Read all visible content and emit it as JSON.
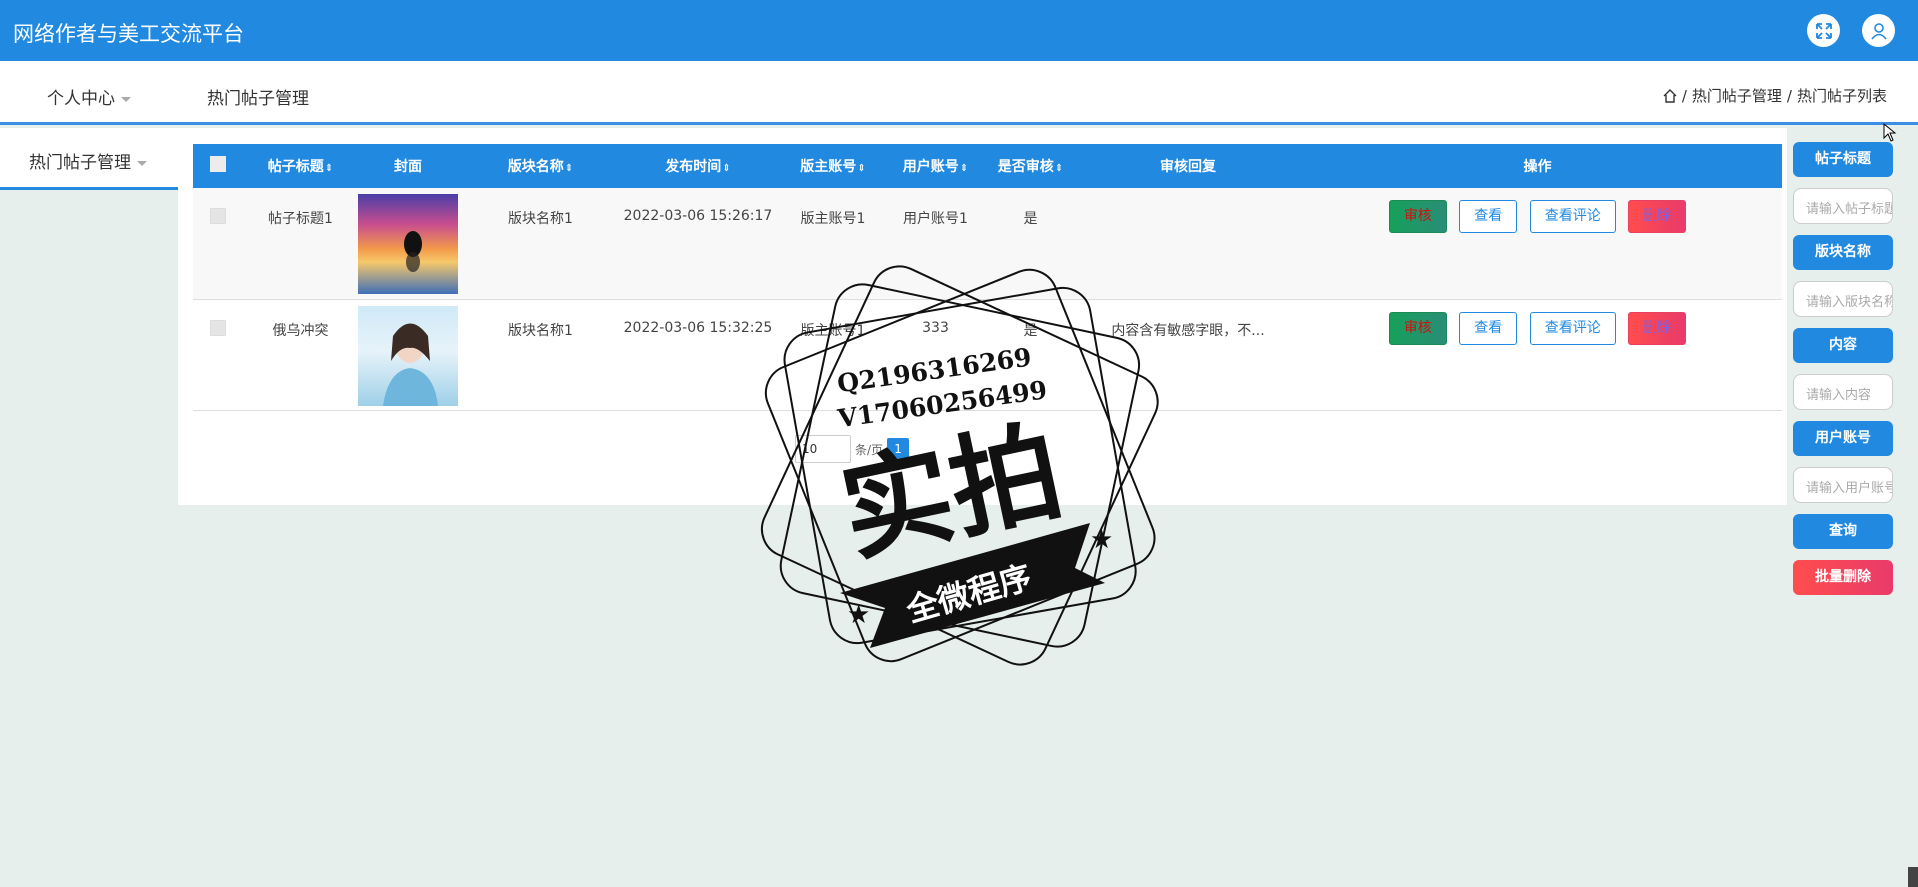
{
  "app": {
    "title": "网络作者与美工交流平台",
    "icons": [
      "fullscreen-icon",
      "user-icon"
    ]
  },
  "nav": {
    "personal_center": "个人中心",
    "hot_posts_manage": "热门帖子管理",
    "breadcrumb": [
      "热门帖子管理",
      "热门帖子列表"
    ],
    "breadcrumb_sep": "/"
  },
  "sidebar": {
    "items": [
      {
        "label": "热门帖子管理"
      }
    ]
  },
  "table": {
    "headers": [
      "帖子标题",
      "封面",
      "版块名称",
      "发布时间",
      "版主账号",
      "用户账号",
      "是否审核",
      "审核回复",
      "操作"
    ],
    "sort_glyph": "⇕",
    "rows": [
      {
        "title": "帖子标题1",
        "cover": "sunset-dolphin-image",
        "section": "版块名称1",
        "published": "2022-03-06 15:26:17",
        "moderator": "版主账号1",
        "user": "用户账号1",
        "audited": "是",
        "reply": ""
      },
      {
        "title": "俄乌冲突",
        "cover": "woman-portrait-image",
        "section": "版块名称1",
        "published": "2022-03-06 15:32:25",
        "moderator": "版主账号1",
        "user": "333",
        "audited": "是",
        "reply": "内容含有敏感字眼，不..."
      }
    ],
    "actions": {
      "audit": "审核",
      "view": "查看",
      "view_comments": "查看评论",
      "delete": "删除"
    }
  },
  "pager": {
    "page_size": "10",
    "per_page_label": "条/页",
    "current_page": "1"
  },
  "search": {
    "title_label": "帖子标题",
    "title_placeholder": "请输入帖子标题",
    "section_label": "版块名称",
    "section_placeholder": "请输入版块名称",
    "content_label": "内容",
    "content_placeholder": "请输入内容",
    "user_label": "用户账号",
    "user_placeholder": "请输入用户账号",
    "query_button": "查询",
    "batch_delete_button": "批量删除"
  },
  "watermark": {
    "qq": "Q2196316269",
    "wechat": "V17060256499",
    "big_text": "实拍",
    "ribbon": "全微程序"
  },
  "colors": {
    "primary": "#2189e0",
    "audit_green": "#16a05a",
    "delete_red": "#ff4d4d",
    "page_bg": "#e6efeb"
  }
}
